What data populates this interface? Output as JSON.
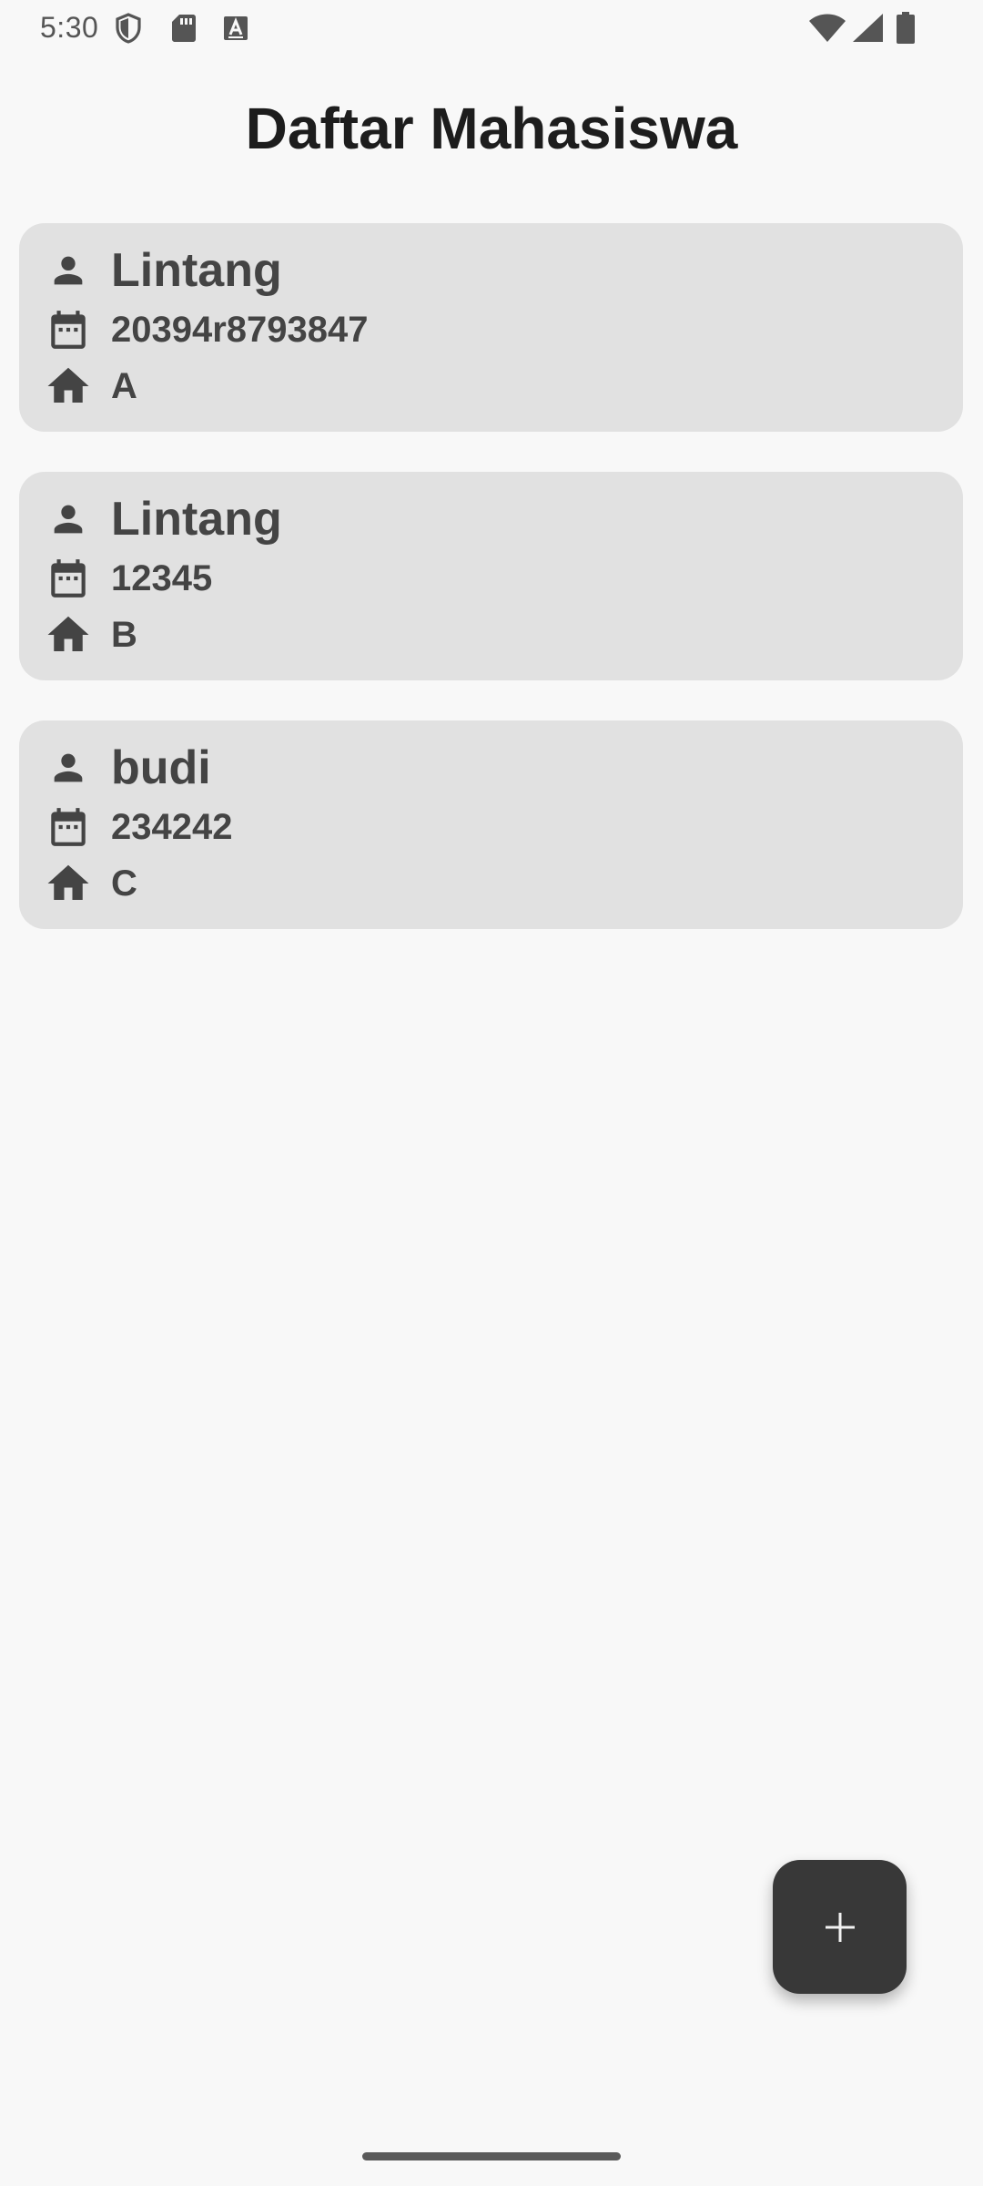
{
  "status_bar": {
    "time": "5:30",
    "icons": [
      "shield-icon",
      "sd-card-icon",
      "a-notification-icon",
      "wifi-icon",
      "signal-icon",
      "battery-icon"
    ]
  },
  "title": "Daftar Mahasiswa",
  "students": [
    {
      "name": "Lintang",
      "nim": "20394r8793847",
      "address": "A"
    },
    {
      "name": "Lintang",
      "nim": "12345",
      "address": "B"
    },
    {
      "name": "budi",
      "nim": "234242",
      "address": "C"
    }
  ],
  "fab": {
    "icon": "plus-icon"
  },
  "colors": {
    "background": "#f8f8f8",
    "card": "#e1e1e1",
    "text": "#444444",
    "title": "#1d1d1d",
    "fab": "#383838"
  }
}
